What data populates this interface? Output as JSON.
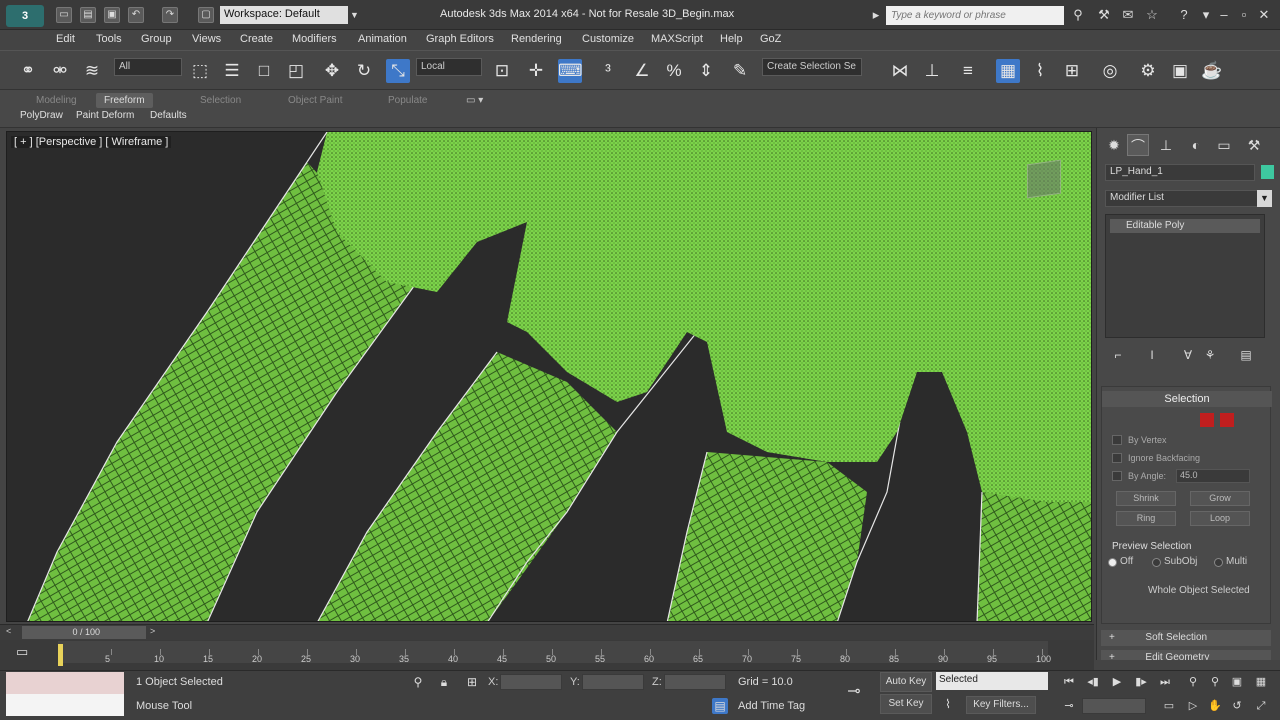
{
  "titlebar": {
    "workspace": "Workspace: Default",
    "title": "Autodesk 3ds Max  2014 x64   - Not for Resale   3D_Begin.max",
    "search_placeholder": "Type a keyword or phrase"
  },
  "menu": [
    "Edit",
    "Tools",
    "Group",
    "Views",
    "Create",
    "Modifiers",
    "Animation",
    "Graph Editors",
    "Rendering",
    "Customize",
    "MAXScript",
    "Help",
    "GoZ"
  ],
  "toolbar": {
    "filter": "All",
    "coord_system": "Local",
    "named_selection": "Create Selection Se"
  },
  "ribbon": {
    "tabs": [
      "Modeling",
      "Freeform",
      "Selection",
      "Object Paint",
      "Populate"
    ],
    "active_tab": "Freeform",
    "panels": [
      "PolyDraw",
      "Paint Deform",
      "Defaults"
    ]
  },
  "viewport": {
    "label": "[ + ] [Perspective ] [ Wireframe ]",
    "mesh_color": "#7cd44a",
    "wire_color": "#e8e8e8"
  },
  "command_panel": {
    "object_name": "LP_Hand_1",
    "object_color": "#3ec8a0",
    "modifier_list": "Modifier List",
    "stack_item": "Editable Poly",
    "selection": {
      "header": "Selection",
      "by_vertex": "By Vertex",
      "ignore_backfacing": "Ignore Backfacing",
      "by_angle": "By Angle:",
      "angle_value": "45.0",
      "shrink": "Shrink",
      "grow": "Grow",
      "ring": "Ring",
      "loop": "Loop",
      "preview_selection": "Preview Selection",
      "preview_off": "Off",
      "preview_subobj": "SubObj",
      "preview_multi": "Multi",
      "whole_object": "Whole Object Selected"
    },
    "soft_selection": "Soft Selection",
    "edit_geometry": "Edit Geometry"
  },
  "timeline": {
    "frame_display": "0 / 100",
    "ticks": [
      "5",
      "10",
      "15",
      "20",
      "25",
      "30",
      "35",
      "40",
      "45",
      "50",
      "55",
      "60",
      "65",
      "70",
      "75",
      "80",
      "85",
      "90",
      "95",
      "100"
    ]
  },
  "status": {
    "objects_selected": "1 Object Selected",
    "prompt": "Mouse Tool",
    "x_label": "X:",
    "y_label": "Y:",
    "z_label": "Z:",
    "grid": "Grid = 10.0",
    "add_time_tag": "Add Time Tag",
    "auto_key": "Auto Key",
    "set_key": "Set Key",
    "key_mode": "Selected",
    "key_filters": "Key Filters..."
  }
}
